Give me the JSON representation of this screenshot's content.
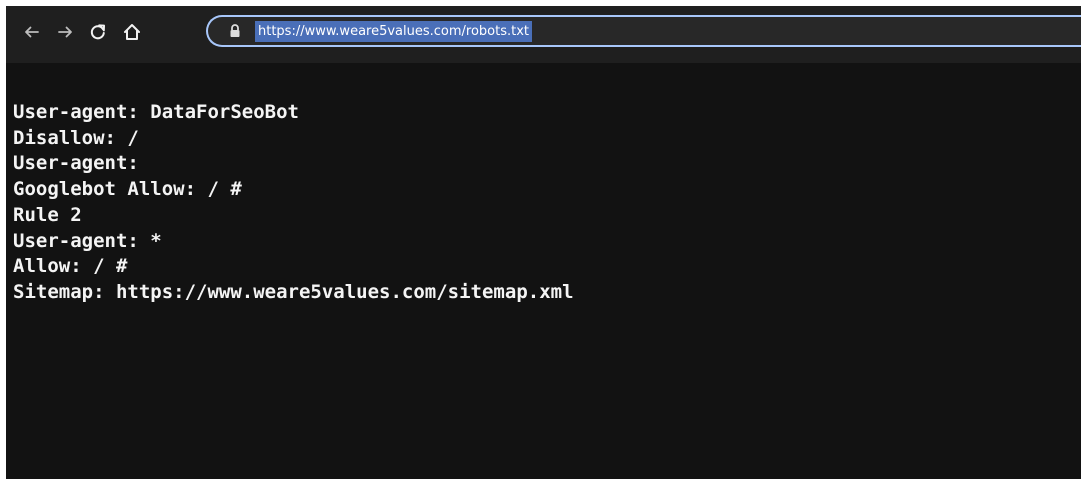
{
  "browser": {
    "url": "https://www.weare5values.com/robots.txt"
  },
  "toolbar_icons": {
    "back": "back-arrow-icon",
    "forward": "forward-arrow-icon",
    "reload": "reload-icon",
    "home": "home-icon",
    "lock": "lock-icon"
  },
  "colors": {
    "page_background": "#121212",
    "toolbar_background": "#1f1f1f",
    "text": "#f4f4f4",
    "url_selection": "#4a6fb8",
    "focus_ring": "#a8c7fa"
  },
  "page": {
    "lines": [
      "User-agent: DataForSeoBot",
      "Disallow: /",
      "User-agent:",
      "Googlebot Allow: / #",
      "Rule 2",
      "User-agent: *",
      "Allow: / #",
      "Sitemap: https://www.weare5values.com/sitemap.xml"
    ]
  }
}
